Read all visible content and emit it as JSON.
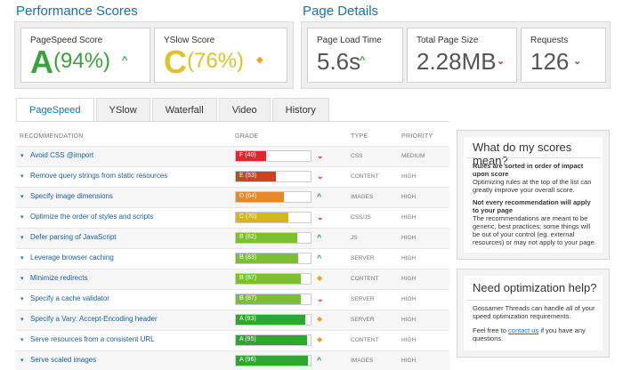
{
  "performance": {
    "title": "Performance Scores",
    "pagespeed": {
      "label": "PageSpeed Score",
      "grade": "A",
      "percent": "(94%)"
    },
    "yslow": {
      "label": "YSlow Score",
      "grade": "C",
      "percent": "(76%)"
    }
  },
  "details": {
    "title": "Page Details",
    "load_time": {
      "label": "Page Load Time",
      "value": "5.6s"
    },
    "page_size": {
      "label": "Total Page Size",
      "value": "2.28MB"
    },
    "requests": {
      "label": "Requests",
      "value": "126"
    }
  },
  "tabs": [
    "PageSpeed",
    "YSlow",
    "Waterfall",
    "Video",
    "History"
  ],
  "table": {
    "headers": {
      "recommendation": "RECOMMENDATION",
      "grade": "GRADE",
      "type": "TYPE",
      "priority": "PRIORITY"
    },
    "rows": [
      {
        "name": "Avoid CSS @import",
        "grade": "F (40)",
        "score": 40,
        "color": "#d62c2c",
        "indicator": "down",
        "type": "CSS",
        "priority": "MEDIUM"
      },
      {
        "name": "Remove query strings from static resources",
        "grade": "E (53)",
        "score": 53,
        "color": "#c9441f",
        "indicator": "down",
        "type": "CONTENT",
        "priority": "HIGH"
      },
      {
        "name": "Specify image dimensions",
        "grade": "D (64)",
        "score": 64,
        "color": "#e5892a",
        "indicator": "up",
        "type": "IMAGES",
        "priority": "HIGH"
      },
      {
        "name": "Optimize the order of styles and scripts",
        "grade": "C (70)",
        "score": 70,
        "color": "#d4b81a",
        "indicator": "down",
        "type": "CSS/JS",
        "priority": "HIGH"
      },
      {
        "name": "Defer parsing of JavaScript",
        "grade": "B (82)",
        "score": 82,
        "color": "#7cbf2f",
        "indicator": "up",
        "type": "JS",
        "priority": "HIGH"
      },
      {
        "name": "Leverage browser caching",
        "grade": "B (83)",
        "score": 83,
        "color": "#7cbf2f",
        "indicator": "up",
        "type": "SERVER",
        "priority": "HIGH"
      },
      {
        "name": "Minimize redirects",
        "grade": "B (87)",
        "score": 87,
        "color": "#7cbf2f",
        "indicator": "diamond",
        "type": "CONTENT",
        "priority": "HIGH"
      },
      {
        "name": "Specify a cache validator",
        "grade": "B (87)",
        "score": 87,
        "color": "#7cbf2f",
        "indicator": "down",
        "type": "SERVER",
        "priority": "HIGH"
      },
      {
        "name": "Specify a Vary: Accept-Encoding header",
        "grade": "A (93)",
        "score": 93,
        "color": "#2fa62f",
        "indicator": "diamond",
        "type": "SERVER",
        "priority": "HIGH"
      },
      {
        "name": "Serve resources from a consistent URL",
        "grade": "A (95)",
        "score": 95,
        "color": "#2fa62f",
        "indicator": "diamond",
        "type": "CONTENT",
        "priority": "HIGH"
      },
      {
        "name": "Serve scaled images",
        "grade": "A (96)",
        "score": 96,
        "color": "#2fa62f",
        "indicator": "up",
        "type": "IMAGES",
        "priority": "HIGH"
      }
    ]
  },
  "scores_box": {
    "title": "What do my scores mean?",
    "p1_bold": "Rules are sorted in order of impact upon score",
    "p1": "Optimizing rules at the top of the list can greatly improve your overall score.",
    "p2_bold": "Not every recommendation will apply to your page",
    "p2": "The recommendations are meant to be generic, best practices; some things will be out of your control (eg. external resources) or may not apply to your page."
  },
  "help_box": {
    "title": "Need optimization help?",
    "p1": "Gossamer Threads can handle all of your speed optimization requirements.",
    "p2_pre": "Feel free to",
    "p2_link": "contact us",
    "p2_post": "if you have any questions."
  },
  "colors": {
    "accent": "#1a6fb5",
    "grade_a": "#3aa23a",
    "grade_c": "#e0c226",
    "up": "#2e9e3e",
    "down": "#d0343a",
    "neutral": "#f0a020"
  }
}
